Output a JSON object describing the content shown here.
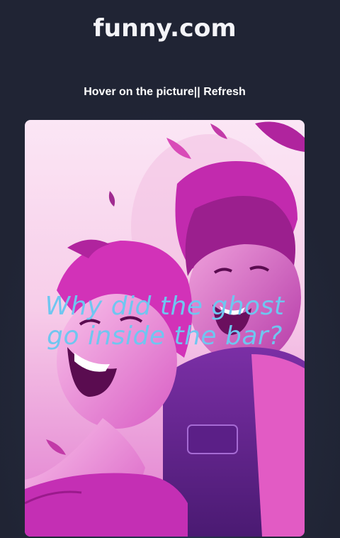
{
  "header": {
    "logo_text": "funny.com"
  },
  "controls": {
    "hint_text": "Hover on the picture||",
    "refresh_label": "Refresh"
  },
  "card": {
    "joke_text": "Why did the ghost go inside the bar?"
  },
  "colors": {
    "background": "#202434",
    "joke_text": "#6fc6f0",
    "image_magenta": "#c42fb4"
  }
}
